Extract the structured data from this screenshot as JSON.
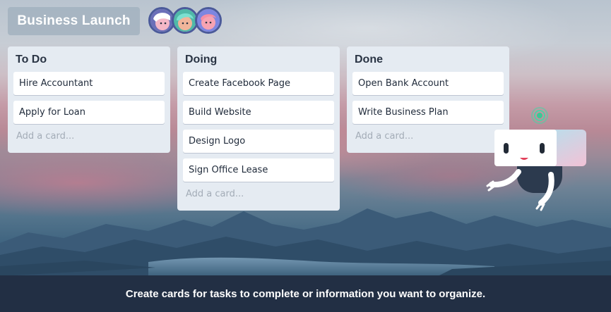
{
  "board": {
    "title": "Business Launch",
    "members": [
      "member-avatar-1",
      "member-avatar-2",
      "member-avatar-3"
    ]
  },
  "lists": [
    {
      "title": "To Do",
      "cards": [
        "Hire Accountant",
        "Apply for Loan"
      ],
      "add_card_label": "Add a card..."
    },
    {
      "title": "Doing",
      "cards": [
        "Create Facebook Page",
        "Build Website",
        "Design Logo",
        "Sign Office Lease"
      ],
      "add_card_label": "Add a card..."
    },
    {
      "title": "Done",
      "cards": [
        "Open Bank Account",
        "Write Business Plan"
      ],
      "add_card_label": "Add a card..."
    }
  ],
  "footer": {
    "caption": "Create cards for tasks to complete or information you want to organize."
  },
  "mascot": {
    "icon": "robot-mascot-icon"
  },
  "colors": {
    "list_background": "#e5ebf2",
    "card_background": "#ffffff",
    "footer_background": "#222e42",
    "avatar_ring": "#4b5a9a"
  }
}
